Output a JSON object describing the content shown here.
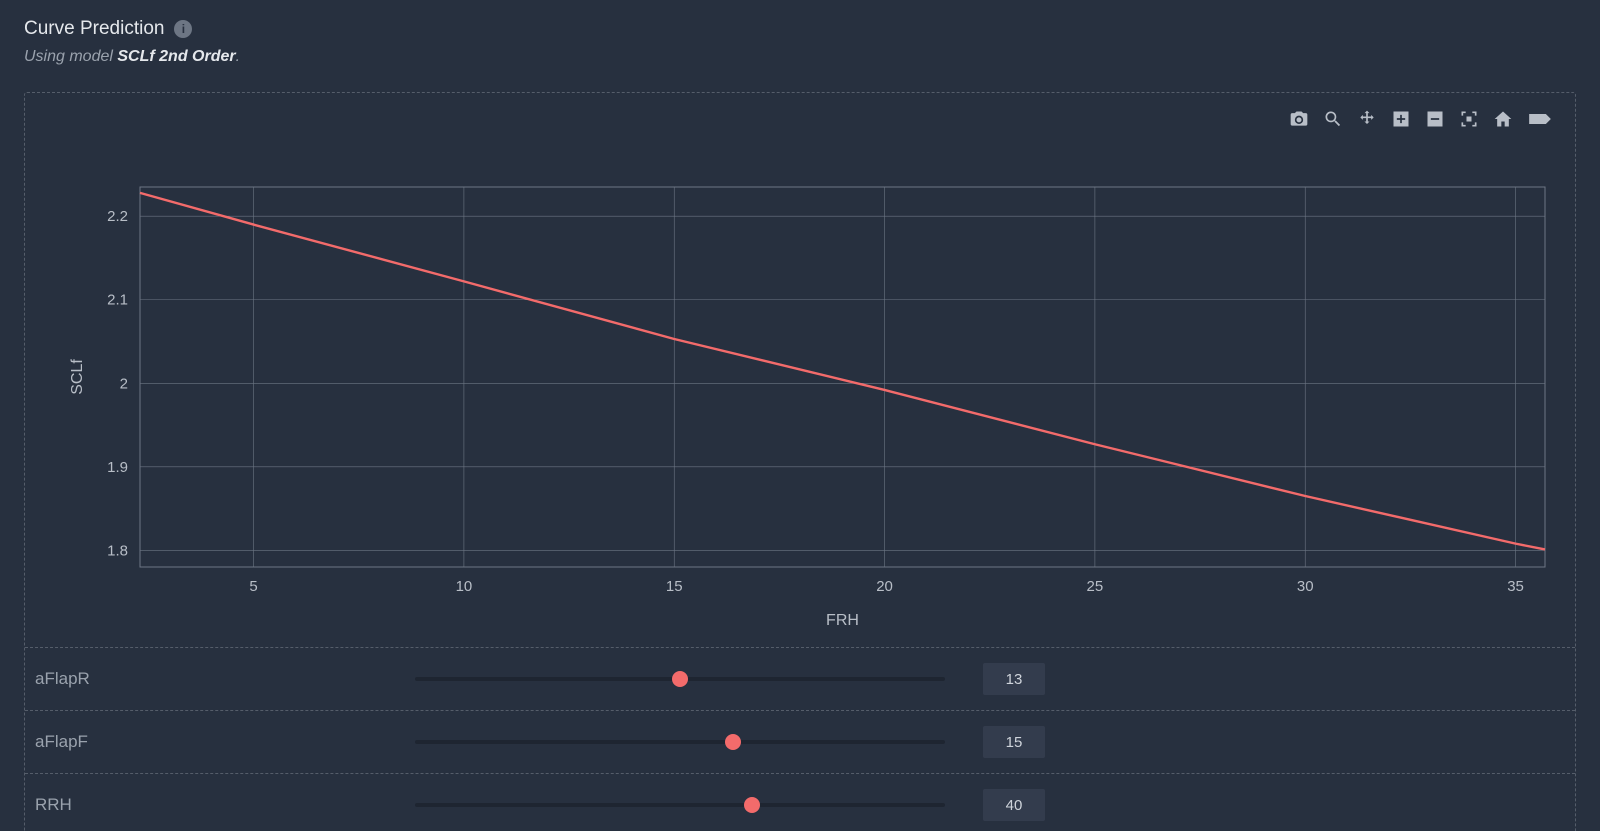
{
  "header": {
    "title": "Curve Prediction",
    "info_glyph": "i",
    "subtitle_prefix": "Using model ",
    "model_name": "SCLf 2nd Order",
    "subtitle_suffix": "."
  },
  "toolbar": {
    "icons": [
      "camera-icon",
      "zoom-icon",
      "pan-icon",
      "zoom-in-icon",
      "zoom-out-icon",
      "autoscale-icon",
      "home-icon",
      "tag-icon"
    ]
  },
  "sliders": [
    {
      "name": "aFlapR",
      "value": 13,
      "min": 0,
      "max": 26,
      "fraction": 0.5
    },
    {
      "name": "aFlapF",
      "value": 15,
      "min": 0,
      "max": 25,
      "fraction": 0.6
    },
    {
      "name": "RRH",
      "value": 40,
      "min": 0,
      "max": 63,
      "fraction": 0.635
    }
  ],
  "chart_data": {
    "type": "line",
    "title": "",
    "xlabel": "FRH",
    "ylabel": "SCLf",
    "x_ticks": [
      5,
      10,
      15,
      20,
      25,
      30,
      35
    ],
    "y_ticks": [
      1.8,
      1.9,
      2,
      2.1,
      2.2
    ],
    "xlim": [
      2.3,
      35.7
    ],
    "ylim": [
      1.78,
      2.235
    ],
    "grid": true,
    "series": [
      {
        "name": "SCLf",
        "color": "#f36b6b",
        "x": [
          2.3,
          5,
          10,
          15,
          20,
          25,
          30,
          35,
          35.7
        ],
        "y": [
          2.228,
          2.19,
          2.122,
          2.053,
          1.992,
          1.927,
          1.865,
          1.808,
          1.801
        ]
      }
    ]
  }
}
